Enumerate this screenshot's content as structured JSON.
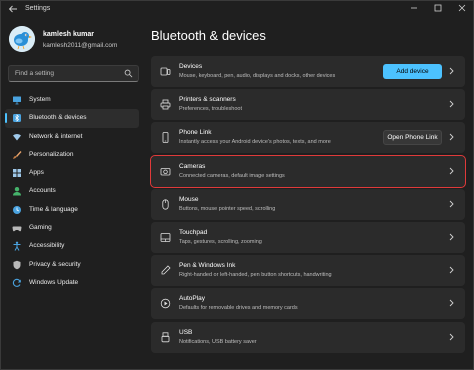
{
  "titlebar": {
    "title": "Settings"
  },
  "user": {
    "name": "kamlesh kumar",
    "email": "kamlesh2011@gmail.com"
  },
  "search": {
    "placeholder": "Find a setting"
  },
  "sidebar": {
    "items": [
      {
        "label": "System",
        "icon": "monitor-icon",
        "color": "#4aa3df"
      },
      {
        "label": "Bluetooth & devices",
        "icon": "bluetooth-icon",
        "color": "#4aa3df",
        "active": true
      },
      {
        "label": "Network & internet",
        "icon": "wifi-icon",
        "color": "#9fc9ea"
      },
      {
        "label": "Personalization",
        "icon": "brush-icon",
        "color": "#e8a36b"
      },
      {
        "label": "Apps",
        "icon": "apps-icon",
        "color": "#9fc9ea"
      },
      {
        "label": "Accounts",
        "icon": "person-icon",
        "color": "#45b36b"
      },
      {
        "label": "Time & language",
        "icon": "globe-clock-icon",
        "color": "#4aa3df"
      },
      {
        "label": "Gaming",
        "icon": "gamepad-icon",
        "color": "#b8b8b8"
      },
      {
        "label": "Accessibility",
        "icon": "accessibility-icon",
        "color": "#4aa3df"
      },
      {
        "label": "Privacy & security",
        "icon": "shield-icon",
        "color": "#b8b8b8"
      },
      {
        "label": "Windows Update",
        "icon": "update-icon",
        "color": "#4aa3df"
      }
    ]
  },
  "main": {
    "title": "Bluetooth & devices",
    "cards": [
      {
        "title": "Devices",
        "subtitle": "Mouse, keyboard, pen, audio, displays and docks, other devices",
        "icon": "devices-icon",
        "button": "Add device"
      },
      {
        "title": "Printers & scanners",
        "subtitle": "Preferences, troubleshoot",
        "icon": "printer-icon"
      },
      {
        "title": "Phone Link",
        "subtitle": "Instantly access your Android device's photos, texts, and more",
        "icon": "phone-icon",
        "button": "Open Phone Link"
      },
      {
        "title": "Cameras",
        "subtitle": "Connected cameras, default image settings",
        "icon": "camera-icon",
        "highlight": true
      },
      {
        "title": "Mouse",
        "subtitle": "Buttons, mouse pointer speed, scrolling",
        "icon": "mouse-icon"
      },
      {
        "title": "Touchpad",
        "subtitle": "Taps, gestures, scrolling, zooming",
        "icon": "touchpad-icon"
      },
      {
        "title": "Pen & Windows Ink",
        "subtitle": "Right-handed or left-handed, pen button shortcuts, handwriting",
        "icon": "pen-icon"
      },
      {
        "title": "AutoPlay",
        "subtitle": "Defaults for removable drives and memory cards",
        "icon": "autoplay-icon"
      },
      {
        "title": "USB",
        "subtitle": "Notifications, USB battery saver",
        "icon": "usb-icon"
      }
    ]
  },
  "colors": {
    "accent": "#4cc2ff",
    "highlight_border": "#e03a3a",
    "card_bg": "#2b2b2b",
    "window_bg": "#1f1f1f"
  }
}
